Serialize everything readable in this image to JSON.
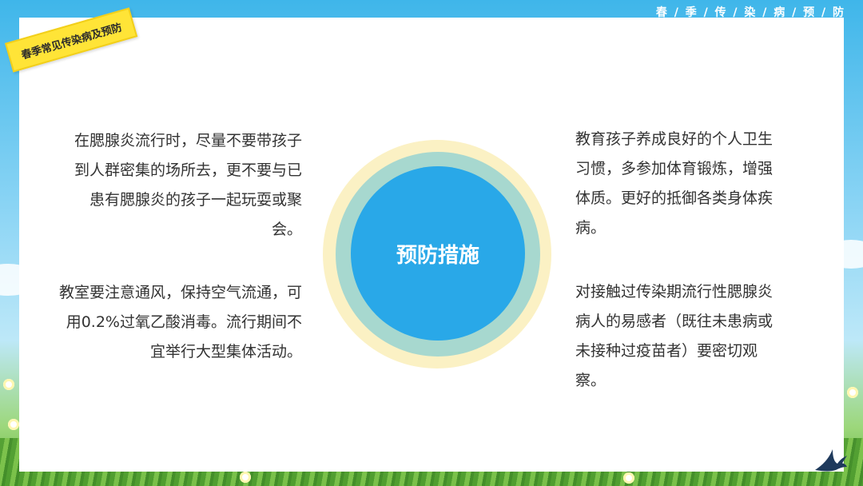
{
  "header": {
    "top_right_title": "春 / 季 / 传 / 染 / 病 / 预 / 防",
    "tape_label": "春季常见传染病及预防"
  },
  "center": {
    "label": "预防措施"
  },
  "blocks": {
    "left_top": "在腮腺炎流行时，尽量不要带孩子到人群密集的场所去，更不要与已患有腮腺炎的孩子一起玩耍或聚会。",
    "left_bottom": "教室要注意通风，保持空气流通，可用0.2%过氧乙酸消毒。流行期间不宜举行大型集体活动。",
    "right_top": "教育孩子养成良好的个人卫生习惯，多参加体育锻炼，增强体质。更好的抵御各类身体疾病。",
    "right_bottom": "对接触过传染期流行性腮腺炎病人的易感者（既往未患病或未接种过疫苗者）要密切观察。"
  },
  "colors": {
    "center_circle": "#29a8e8",
    "middle_ring": "#a7d8cf",
    "outer_ring": "#fbf1c4",
    "tape": "#ffe437"
  }
}
